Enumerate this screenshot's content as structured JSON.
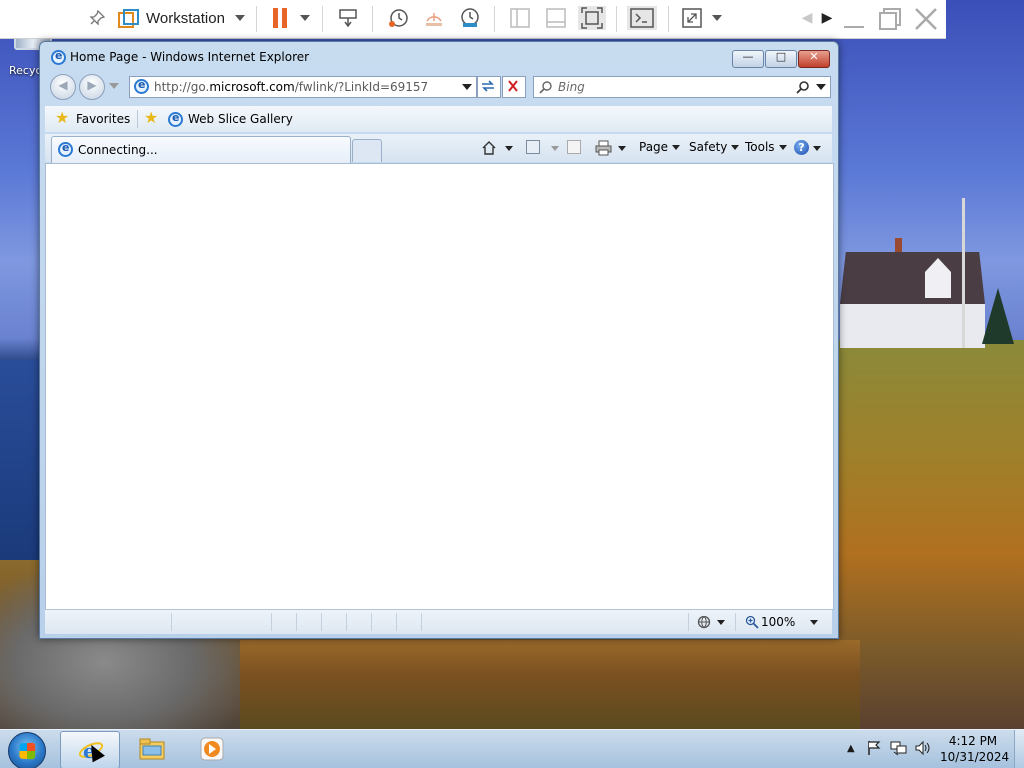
{
  "desktop": {
    "recycle_bin_label": "Recyc"
  },
  "vmware_toolbar": {
    "title": "Workstation",
    "icons": [
      "pin-icon",
      "vmware-logo-icon",
      "pause-icon",
      "send-ctrl-alt-del-icon",
      "snapshot-icon",
      "revert-snapshot-icon",
      "snapshot-manager-icon",
      "library-view-icon",
      "thumbnail-view-icon",
      "fit-guest-icon",
      "console-view-icon",
      "fullscreen-icon",
      "back-icon",
      "forward-icon",
      "minimize-icon",
      "restore-icon",
      "close-icon"
    ],
    "accent_color": "#e8652a"
  },
  "ie_window": {
    "title": "Home Page - Windows Internet Explorer",
    "address_prefix": "http://go.",
    "address_domain": "microsoft.com",
    "address_suffix": "/fwlink/?LinkId=69157",
    "search_placeholder": "Bing",
    "favorites_label": "Favorites",
    "web_slice_label": "Web Slice Gallery",
    "tab_label": "Connecting...",
    "menu": {
      "page": "Page",
      "safety": "Safety",
      "tools": "Tools"
    },
    "zoom": "100%"
  },
  "taskbar": {
    "time": "4:12 PM",
    "date": "10/31/2024",
    "pinned": [
      "internet-explorer-icon",
      "windows-explorer-icon",
      "media-player-icon"
    ]
  }
}
